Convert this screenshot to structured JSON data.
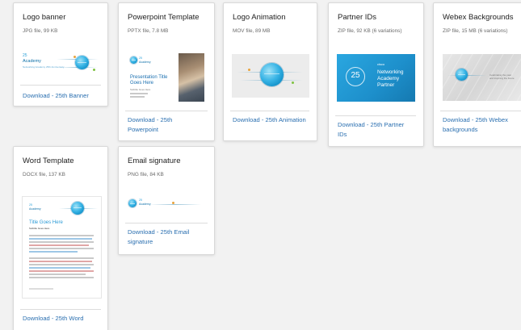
{
  "cards": [
    {
      "title": "Logo banner",
      "meta": "JPG file, 99 KB",
      "link": [
        "Download - 25th Banner"
      ]
    },
    {
      "title": "Powerpoint Template",
      "meta": "PPTX file, 7.8 MB",
      "link": [
        "Download - 25th",
        "Powerpoint"
      ]
    },
    {
      "title": "Logo Animation",
      "meta": "MOV file, 89 MB",
      "link": [
        "Download - 25th Animation"
      ]
    },
    {
      "title": "Partner IDs",
      "meta": "ZIP file, 92 KB (6 variations)",
      "link": [
        "Download - 25th Partner",
        "IDs"
      ]
    },
    {
      "title": "Webex Backgrounds",
      "meta": "ZIP file, 15 MB (6 variations)",
      "link": [
        "Download - 25th Webex",
        "backgrounds"
      ]
    },
    {
      "title": "Word Template",
      "meta": "DOCX file, 137 KB",
      "link": [
        "Download - 25th Word"
      ]
    },
    {
      "title": "Email signature",
      "meta": "PNG file, 84 KB",
      "link": [
        "Download - 25th Email",
        "signature"
      ]
    }
  ],
  "thumbs": {
    "banner": {
      "line1": "25",
      "line2": "Academy",
      "line3": "Networking Academy 25th Anniversary"
    },
    "ppt": {
      "line1": "25",
      "line2": "Academy",
      "title1": "Presentation Title",
      "title2": "Goes Here",
      "sub": "Subtitle Goes Here"
    },
    "partner": {
      "brand": "cisco",
      "line1": "Networking",
      "line2": "Academy",
      "line3": "Partner",
      "badge": "25"
    },
    "webex": {
      "caption": "Celebrating the past and inspiring the future"
    },
    "word": {
      "line1": "25",
      "line2": "Academy",
      "title": "Title Goes Here",
      "sub": "Subtitle Goes Here"
    },
    "email": {
      "line1": "25",
      "line2": "Academy"
    }
  },
  "colors": {
    "link": "#2a6fb0",
    "globe": "#1fa3dc",
    "background": "#f2f2f2"
  }
}
